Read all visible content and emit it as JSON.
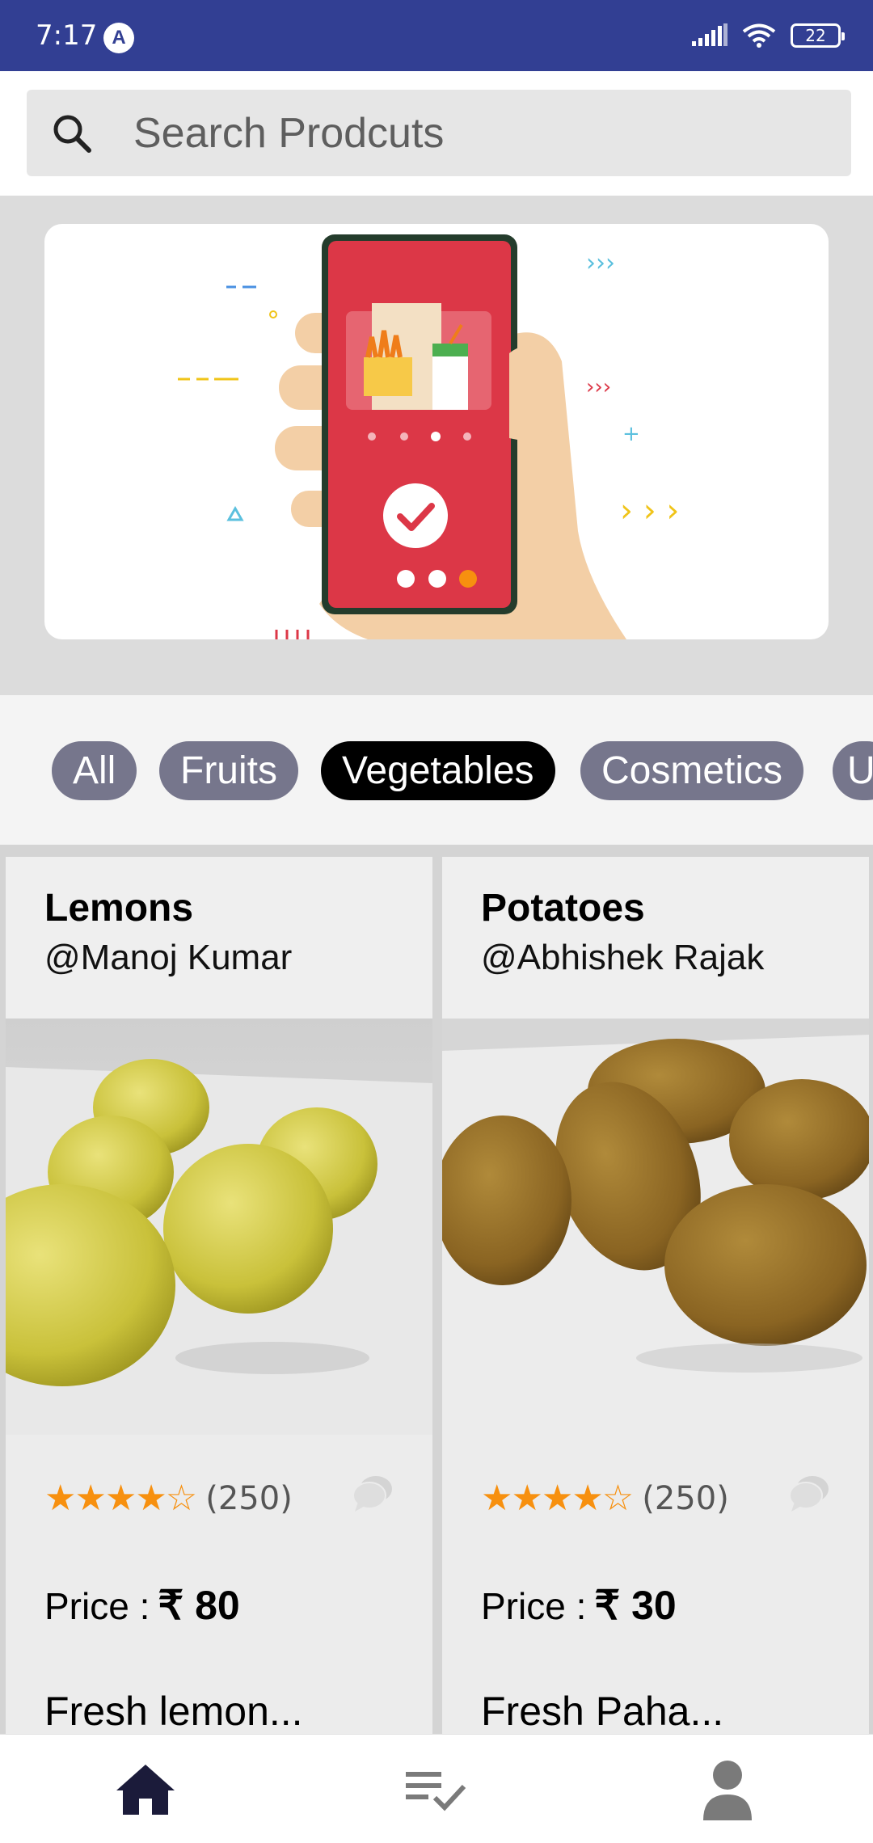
{
  "status_bar": {
    "time": "7:17",
    "app_badge": "A",
    "battery": "22"
  },
  "search": {
    "placeholder": "Search Prodcuts"
  },
  "categories": [
    {
      "label": "All",
      "active": false
    },
    {
      "label": "Fruits",
      "active": false
    },
    {
      "label": "Vegetables",
      "active": true
    },
    {
      "label": "Cosmetics",
      "active": false
    },
    {
      "label": "U",
      "active": false
    }
  ],
  "products": [
    {
      "title": "Lemons",
      "seller": "@Manoj Kumar",
      "rating": 3.5,
      "rating_count": "(250)",
      "price_label": "Price :",
      "price_value": "₹ 80",
      "description": "Fresh lemon..."
    },
    {
      "title": "Potatoes",
      "seller": "@Abhishek Rajak",
      "rating": 3.5,
      "rating_count": "(250)",
      "price_label": "Price :",
      "price_value": "₹ 30",
      "description": "Fresh Paha..."
    }
  ],
  "colors": {
    "status_bar": "#323f93",
    "chip": "#76768c",
    "chip_active": "#000000",
    "star": "#f7900f",
    "phone_screen": "#dc3747"
  },
  "bottom_nav": [
    {
      "icon": "home-icon",
      "active": true
    },
    {
      "icon": "checklist-icon",
      "active": false
    },
    {
      "icon": "person-icon",
      "active": false
    }
  ]
}
